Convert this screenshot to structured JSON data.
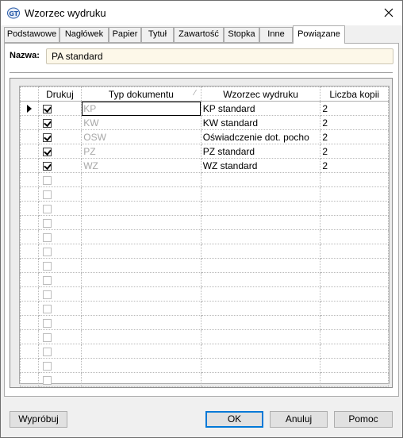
{
  "window": {
    "title": "Wzorzec wydruku",
    "icons": {
      "app": "app-logo-icon",
      "close": "close-icon"
    }
  },
  "tabs": [
    {
      "label": "Podstawowe",
      "active": false
    },
    {
      "label": "Nagłówek",
      "active": false
    },
    {
      "label": "Papier",
      "active": false
    },
    {
      "label": "Tytuł",
      "active": false
    },
    {
      "label": "Zawartość",
      "active": false
    },
    {
      "label": "Stopka",
      "active": false
    },
    {
      "label": "Inne",
      "active": false
    },
    {
      "label": "Powiązane",
      "active": true
    }
  ],
  "form": {
    "name_label": "Nazwa:",
    "name_value": "PA standard"
  },
  "table": {
    "columns": [
      "Drukuj",
      "Typ dokumentu",
      "Wzorzec wydruku",
      "Liczba kopii"
    ],
    "rows": [
      {
        "print": true,
        "type": "KP",
        "template": "KP standard",
        "copies": "2",
        "current": true
      },
      {
        "print": true,
        "type": "KW",
        "template": "KW standard",
        "copies": "2",
        "current": false
      },
      {
        "print": true,
        "type": "OSW",
        "template": "Oświadczenie dot. pocho",
        "copies": "2",
        "current": false
      },
      {
        "print": true,
        "type": "PZ",
        "template": "PZ standard",
        "copies": "2",
        "current": false
      },
      {
        "print": true,
        "type": "WZ",
        "template": "WZ standard",
        "copies": "2",
        "current": false
      }
    ],
    "empty_rows": 15
  },
  "buttons": {
    "try": "Wypróbuj",
    "ok": "OK",
    "cancel": "Anuluj",
    "help": "Pomoc"
  },
  "colors": {
    "name_field_bg": "#fdf8e9",
    "default_button_border": "#0078d7",
    "disabled_text": "#a8a8a8"
  }
}
